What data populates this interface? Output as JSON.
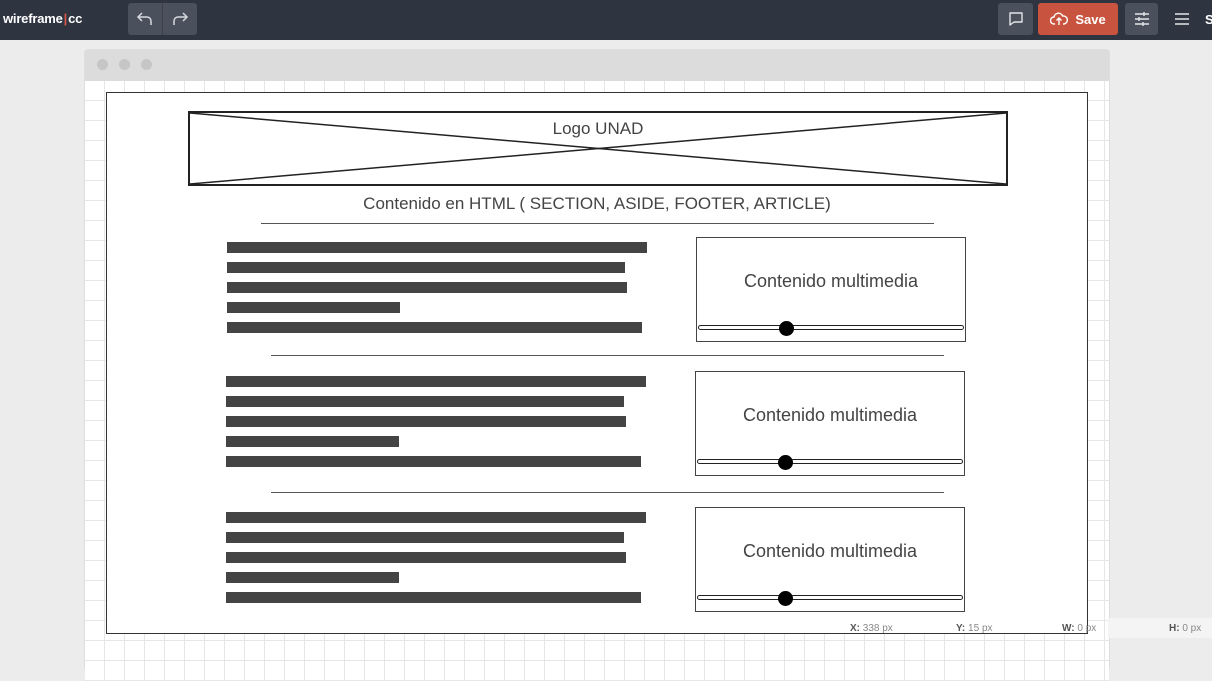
{
  "app": {
    "logo_left": "wireframe",
    "logo_sep": "|",
    "logo_right": "cc",
    "save_label": "Save",
    "cut_label": "S"
  },
  "icons": {
    "undo": "undo-icon",
    "redo": "redo-icon",
    "comment": "comment-icon",
    "cloud_upload": "cloud-upload-icon",
    "settings": "sliders-icon",
    "menu": "hamburger-menu-icon"
  },
  "wireframe": {
    "logo_placeholder": "Logo UNAD",
    "heading": "Contenido en HTML ( SECTION, ASIDE, FOOTER, ARTICLE)",
    "sections": [
      {
        "media_label": "Contenido multimedia"
      },
      {
        "media_label": "Contenido multimedia"
      },
      {
        "media_label": "Contenido multimedia"
      }
    ]
  },
  "status": {
    "x_label": "X:",
    "x_value": "338 px",
    "y_label": "Y:",
    "y_value": "15 px",
    "w_label": "W:",
    "w_value": "0 px",
    "h_label": "H:",
    "h_value": "0 px"
  },
  "colors": {
    "topbar": "#2f3441",
    "save_button": "#c8533f",
    "tool_button": "#4a505c"
  }
}
